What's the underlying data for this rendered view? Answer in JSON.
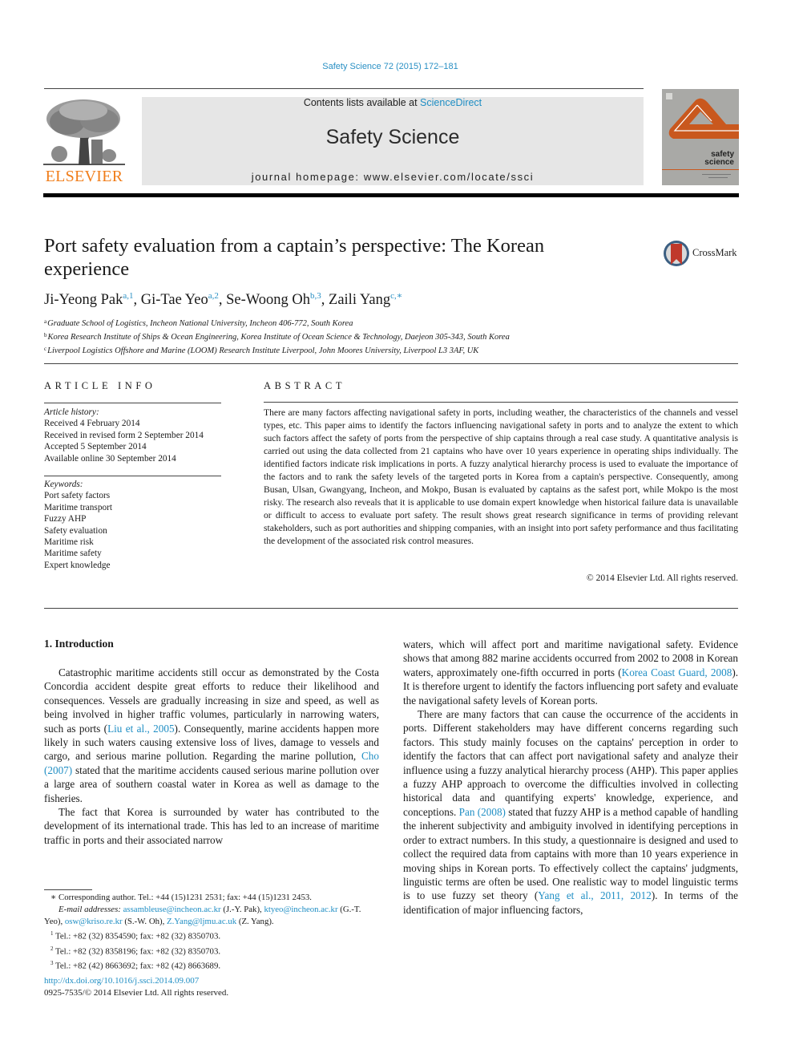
{
  "header": {
    "journal_ref": "Safety Science 72 (2015) 172–181",
    "contents_prefix": "Contents lists available at ",
    "contents_link": "ScienceDirect",
    "journal_title": "Safety Science",
    "homepage_prefix": "journal homepage: ",
    "homepage_url": "www.elsevier.com/locate/ssci",
    "publisher_logo": "ELSEVIER",
    "cover_title_1": "safety",
    "cover_title_2": "science",
    "crossmark_label": "CrossMark"
  },
  "colors": {
    "link": "#1f8ec4",
    "elsevier_orange": "#f07d1a",
    "cover_orange": "#c9581e",
    "cover_gray": "#a9a9a6"
  },
  "title": {
    "line1": "Port safety evaluation from a captain’s perspective: The Korean",
    "line2": "experience"
  },
  "authors": [
    {
      "name": "Ji-Yeong Pak",
      "sup": "a,1"
    },
    {
      "name": "Gi-Tae Yeo",
      "sup": "a,2"
    },
    {
      "name": "Se-Woong Oh",
      "sup": "b,3"
    },
    {
      "name": "Zaili Yang",
      "sup": "c,∗"
    }
  ],
  "affiliations": [
    {
      "mark": "a",
      "text": "Graduate School of Logistics, Incheon National University, Incheon 406-772, South Korea"
    },
    {
      "mark": "b",
      "text": "Korea Research Institute of Ships & Ocean Engineering, Korea Institute of Ocean Science & Technology, Daejeon 305-343, South Korea"
    },
    {
      "mark": "c",
      "text": "Liverpool Logistics Offshore and Marine (LOOM) Research Institute Liverpool, John Moores University, Liverpool L3 3AF, UK"
    }
  ],
  "article_info": {
    "heading": "ARTICLE INFO",
    "history_label": "Article history:",
    "history": [
      "Received 4 February 2014",
      "Received in revised form 2 September 2014",
      "Accepted 5 September 2014",
      "Available online 30 September 2014"
    ],
    "keywords_label": "Keywords:",
    "keywords": [
      "Port safety factors",
      "Maritime transport",
      "Fuzzy AHP",
      "Safety evaluation",
      "Maritime risk",
      "Maritime safety",
      "Expert knowledge"
    ]
  },
  "abstract": {
    "heading": "ABSTRACT",
    "text": "There are many factors affecting navigational safety in ports, including weather, the characteristics of the channels and vessel types, etc. This paper aims to identify the factors influencing navigational safety in ports and to analyze the extent to which such factors affect the safety of ports from the perspective of ship captains through a real case study. A quantitative analysis is carried out using the data collected from 21 captains who have over 10 years experience in operating ships individually. The identified factors indicate risk implications in ports. A fuzzy analytical hierarchy process is used to evaluate the importance of the factors and to rank the safety levels of the targeted ports in Korea from a captain's perspective. Consequently, among Busan, Ulsan, Gwangyang, Incheon, and Mokpo, Busan is evaluated by captains as the safest port, while Mokpo is the most risky. The research also reveals that it is applicable to use domain expert knowledge when historical failure data is unavailable or difficult to access to evaluate port safety. The result shows great research significance in terms of providing relevant stakeholders, such as port authorities and shipping companies, with an insight into port safety performance and thus facilitating the development of the associated risk control measures.",
    "copyright": "© 2014 Elsevier Ltd. All rights reserved."
  },
  "body": {
    "section_heading": "1. Introduction",
    "left_p1_a": "Catastrophic maritime accidents still occur as demonstrated by the Costa Concordia accident despite great efforts to reduce their likelihood and consequences. Vessels are gradually increasing in size and speed, as well as being involved in higher traffic volumes, particularly in narrowing waters, such as ports (",
    "left_p1_link1": "Liu et al., 2005",
    "left_p1_b": "). Consequently, marine accidents happen more likely in such waters causing extensive loss of lives, damage to vessels and cargo, and serious marine pollution. Regarding the marine pollution, ",
    "left_p1_link2": "Cho (2007)",
    "left_p1_c": " stated that the maritime accidents caused serious marine pollution over a large area of southern coastal water in Korea as well as damage to the fisheries.",
    "left_p2": "The fact that Korea is surrounded by water has contributed to the development of its international trade. This has led to an increase of maritime traffic in ports and their associated narrow",
    "right_p1_a": "waters, which will affect port and maritime navigational safety. Evidence shows that among 882 marine accidents occurred from 2002 to 2008 in Korean waters, approximately one-fifth occurred in ports (",
    "right_p1_link1": "Korea Coast Guard, 2008",
    "right_p1_b": "). It is therefore urgent to identify the factors influencing port safety and evaluate the navigational safety levels of Korean ports.",
    "right_p2_a": "There are many factors that can cause the occurrence of the accidents in ports. Different stakeholders may have different concerns regarding such factors. This study mainly focuses on the captains' perception in order to identify the factors that can affect port navigational safety and analyze their influence using a fuzzy analytical hierarchy process (AHP). This paper applies a fuzzy AHP approach to overcome the difficulties involved in collecting historical data and quantifying experts' knowledge, experience, and conceptions. ",
    "right_p2_link1": "Pan (2008)",
    "right_p2_b": " stated that fuzzy AHP is a method capable of handling the inherent subjectivity and ambiguity involved in identifying perceptions in order to extract numbers. In this study, a questionnaire is designed and used to collect the required data from captains with more than 10 years experience in moving ships in Korean ports. To effectively collect the captains' judgments, linguistic terms are often be used. One realistic way to model linguistic terms is to use fuzzy set theory (",
    "right_p2_link2": "Yang et al., 2011, 2012",
    "right_p2_c": "). In terms of the identification of major influencing factors,"
  },
  "footnotes": {
    "corresponding": "Corresponding author. Tel.: +44 (15)1231 2531; fax: +44 (15)1231 2453.",
    "email_label": "E-mail addresses:",
    "emails": [
      {
        "addr": "assambleuse@incheon.ac.kr",
        "who": "(J.-Y. Pak),"
      },
      {
        "addr": "ktyeo@incheon.ac.kr",
        "who": "(G.-T. Yeo),"
      },
      {
        "addr": "osw@kriso.re.kr",
        "who": "(S.-W. Oh),"
      },
      {
        "addr": "Z.Yang@ljmu.ac.uk",
        "who": "(Z. Yang)."
      }
    ],
    "notes": [
      {
        "mark": "1",
        "text": "Tel.: +82 (32) 8354590; fax: +82 (32) 8350703."
      },
      {
        "mark": "2",
        "text": "Tel.: +82 (32) 8358196; fax: +82 (32) 8350703."
      },
      {
        "mark": "3",
        "text": "Tel.: +82 (42) 8663692; fax: +82 (42) 8663689."
      }
    ],
    "doi": "http://dx.doi.org/10.1016/j.ssci.2014.09.007",
    "issn_line": "0925-7535/© 2014 Elsevier Ltd. All rights reserved."
  }
}
